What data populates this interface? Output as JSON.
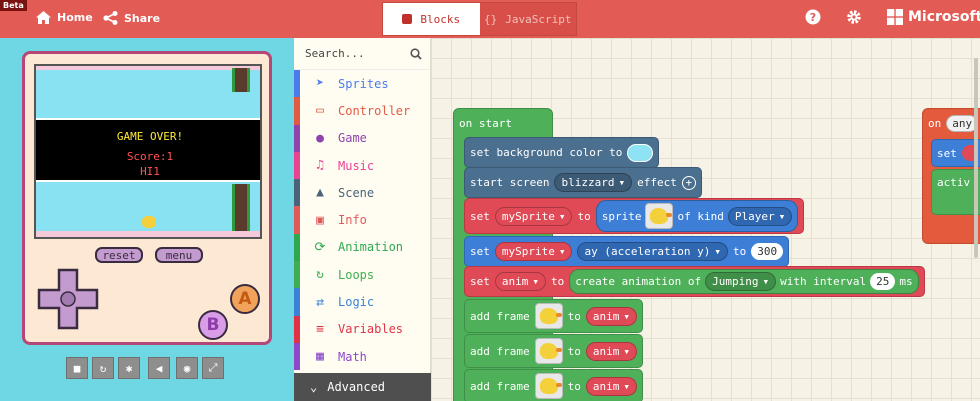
{
  "header": {
    "beta": "Beta",
    "home": "Home",
    "share": "Share",
    "tab_blocks": "Blocks",
    "tab_js": "JavaScript",
    "brand": "Microsoft"
  },
  "simulator": {
    "game_over": "GAME OVER!",
    "score": "Score:1",
    "hi": "HI1",
    "reset": "reset",
    "menu": "menu",
    "btn_a": "A",
    "btn_b": "B"
  },
  "toolbox": {
    "search_placeholder": "Search...",
    "categories": [
      {
        "label": "Sprites",
        "color": "#4b7bec"
      },
      {
        "label": "Controller",
        "color": "#e15a43"
      },
      {
        "label": "Game",
        "color": "#8e44ad"
      },
      {
        "label": "Music",
        "color": "#e84393"
      },
      {
        "label": "Scene",
        "color": "#4a6378"
      },
      {
        "label": "Info",
        "color": "#e15a5a"
      },
      {
        "label": "Animation",
        "color": "#2ea84f"
      },
      {
        "label": "Loops",
        "color": "#3fae52"
      },
      {
        "label": "Logic",
        "color": "#3b82d6"
      },
      {
        "label": "Variables",
        "color": "#e03246"
      },
      {
        "label": "Math",
        "color": "#8c48c8"
      }
    ],
    "advanced": "Advanced"
  },
  "blocks": {
    "on_start": "on start",
    "set_bg": "set background color to",
    "start_screen": "start screen",
    "blizzard": "blizzard",
    "effect": "effect",
    "set": "set",
    "mysprite": "mySprite",
    "to": "to",
    "sprite": "sprite",
    "of_kind": "of kind",
    "player": "Player",
    "ay": "ay (acceleration y)",
    "ay_value": "300",
    "anim": "anim",
    "create_anim": "create animation of",
    "jumping": "Jumping",
    "with_interval": "with interval",
    "interval": "25",
    "ms": "ms",
    "add_frame": "add frame",
    "on": "on",
    "any": "any",
    "activ": "activ"
  }
}
